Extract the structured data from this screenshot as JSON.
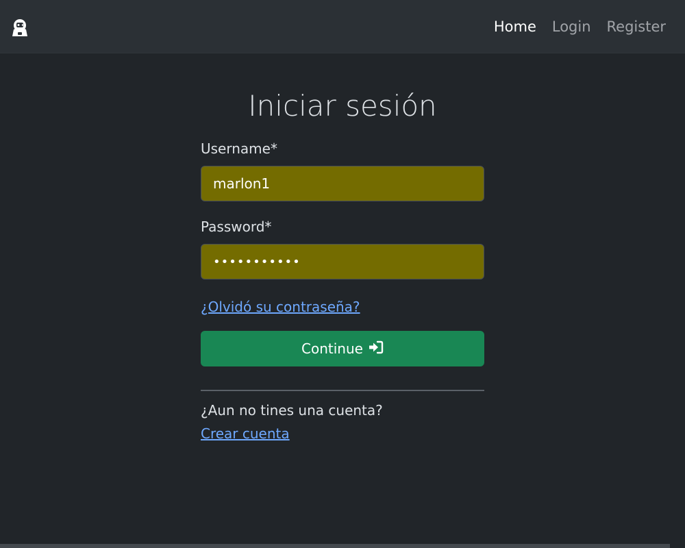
{
  "nav": {
    "logo_icon": "astronaut-logo-icon",
    "links": [
      {
        "label": "Home",
        "active": true
      },
      {
        "label": "Login",
        "active": false
      },
      {
        "label": "Register",
        "active": false
      }
    ]
  },
  "form": {
    "title": "Iniciar sesión",
    "username_label": "Username*",
    "username_value": "marlon1",
    "password_label": "Password*",
    "password_value": "marlon12345",
    "forgot_link": "¿Olvidó su contraseña?",
    "continue_label": "Continue",
    "continue_icon": "sign-in-icon",
    "no_account_text": "¿Aun no tines una cuenta?",
    "create_account_link": "Crear cuenta"
  },
  "colors": {
    "background": "#212529",
    "navbar": "#2b3035",
    "autofill_input": "#746c00",
    "primary_button": "#198754",
    "link": "#6ea8fe"
  }
}
